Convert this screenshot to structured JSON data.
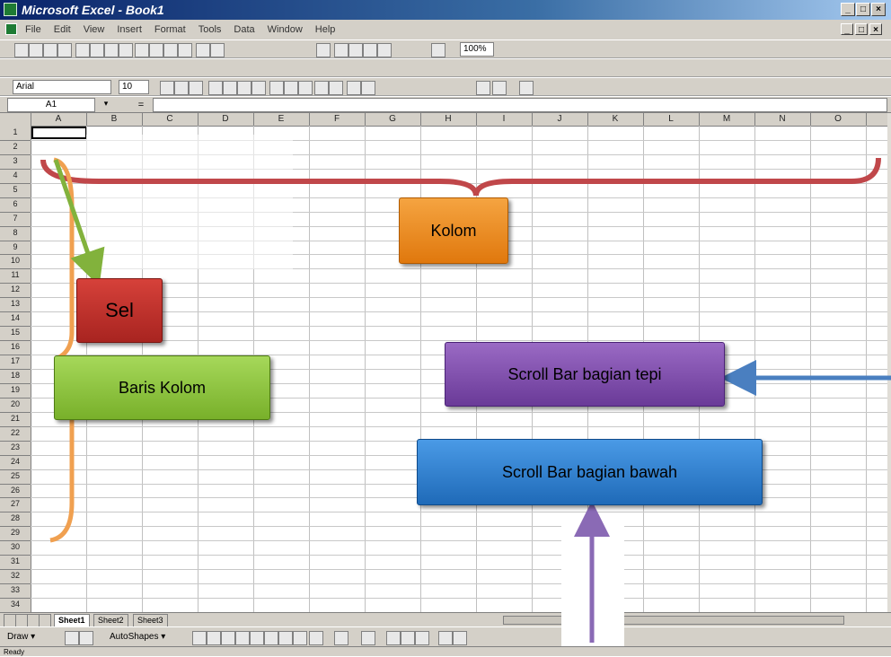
{
  "window": {
    "title": "Microsoft Excel - Book1",
    "controls": [
      "_",
      "□",
      "×"
    ],
    "doc_controls": [
      "_",
      "□",
      "×"
    ]
  },
  "menu": {
    "items": [
      "File",
      "Edit",
      "View",
      "Insert",
      "Format",
      "Tools",
      "Data",
      "Window",
      "Help"
    ]
  },
  "format_toolbar": {
    "font": "Arial",
    "size": "10",
    "zoom": "100%"
  },
  "formula_bar": {
    "name_box": "A1",
    "fx": "="
  },
  "columns": [
    "A",
    "B",
    "C",
    "D",
    "E",
    "F",
    "G",
    "H",
    "I",
    "J",
    "K",
    "L",
    "M",
    "N",
    "O"
  ],
  "rows": [
    "1",
    "2",
    "3",
    "4",
    "5",
    "6",
    "7",
    "8",
    "9",
    "10",
    "11",
    "12",
    "13",
    "14",
    "15",
    "16",
    "17",
    "18",
    "19",
    "20",
    "21",
    "22",
    "23",
    "24",
    "25",
    "26",
    "27",
    "28",
    "29",
    "30",
    "31",
    "32",
    "33",
    "34"
  ],
  "sheets": {
    "tabs": [
      "Sheet1",
      "Sheet2",
      "Sheet3"
    ],
    "active": "Sheet1"
  },
  "draw_toolbar": {
    "draw": "Draw ▾",
    "autoshapes": "AutoShapes ▾"
  },
  "status": {
    "text": "Ready"
  },
  "annotations": {
    "kolom": "Kolom",
    "sel": "Sel",
    "baris": "Baris Kolom",
    "scroll_tepi": "Scroll Bar bagian tepi",
    "scroll_bawah": "Scroll Bar bagian bawah"
  },
  "colors": {
    "brace_red": "#c0474a",
    "orange_box": "#ee8a1b",
    "red_box": "#c0302a",
    "green_box": "#8cc43a",
    "purple_box": "#7a4aa5",
    "blue_box": "#2f7fd0",
    "arrow_green": "#82b23c",
    "arrow_orange": "#f0a050",
    "arrow_blue": "#4a7fc0",
    "arrow_purple": "#8a6ab5"
  }
}
